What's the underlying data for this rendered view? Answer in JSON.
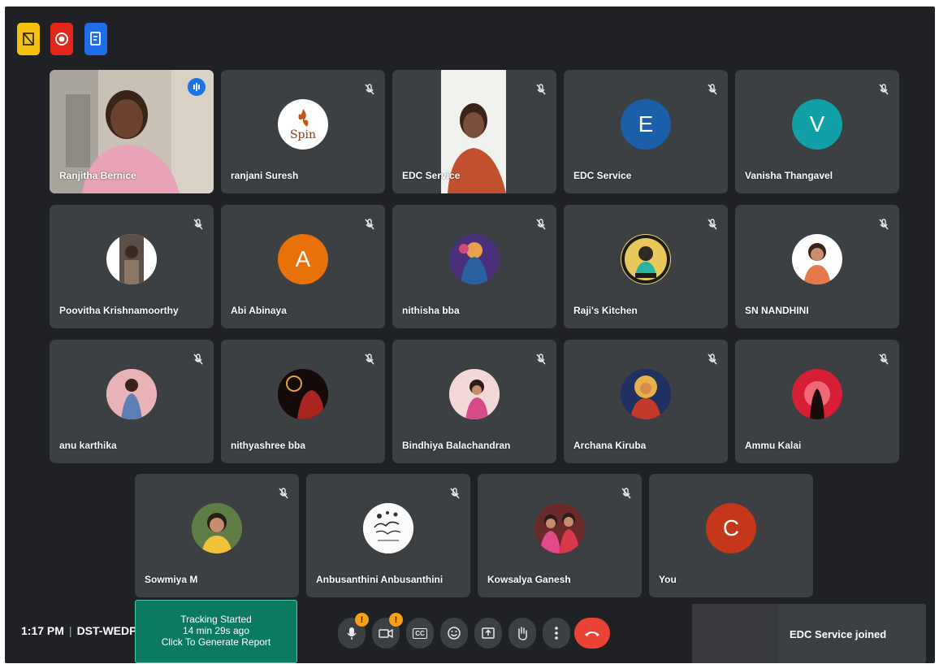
{
  "top_icons": [
    "tracker-icon",
    "record-icon",
    "notes-icon"
  ],
  "participants_row1": [
    {
      "name": "Ranjitha Bernice",
      "kind": "video",
      "active": true
    },
    {
      "name": "ranjani Suresh",
      "kind": "logo",
      "avatar_text": "Spin"
    },
    {
      "name": "EDC Service",
      "kind": "video"
    },
    {
      "name": "EDC Service",
      "kind": "letter",
      "avatar_text": "E",
      "color": "#1a5fa8"
    },
    {
      "name": "Vanisha Thangavel",
      "kind": "letter",
      "avatar_text": "V",
      "color": "#12a0a8"
    }
  ],
  "participants_row2": [
    {
      "name": "Poovitha Krishnamoorthy"
    },
    {
      "name": "Abi Abinaya",
      "avatar_text": "A",
      "color": "#e8710a"
    },
    {
      "name": "nithisha bba"
    },
    {
      "name": "Raji's Kitchen",
      "avatar_text": "RAJI'S KITCHEN"
    },
    {
      "name": "SN NANDHINI"
    }
  ],
  "participants_row3": [
    {
      "name": "anu karthika"
    },
    {
      "name": "nithyashree bba"
    },
    {
      "name": "Bindhiya Balachandran"
    },
    {
      "name": "Archana Kiruba"
    },
    {
      "name": "Ammu Kalai"
    }
  ],
  "participants_row4": [
    {
      "name": "Sowmiya M"
    },
    {
      "name": "Anbusanthini Anbusanthini"
    },
    {
      "name": "Kowsalya Ganesh"
    },
    {
      "name": "You",
      "avatar_text": "C",
      "color": "#c5371a"
    }
  ],
  "meeting": {
    "time": "1:17 PM",
    "separator": "|",
    "code": "DST-WEDP"
  },
  "tracking": {
    "line1": "Tracking Started",
    "line2": "14 min 29s ago",
    "line3": "Click To Generate Report"
  },
  "controls": {
    "mic_badge": "!",
    "camera_badge": "!",
    "captions_label": "CC"
  },
  "toast": {
    "text": "EDC Service joined"
  },
  "colors": {
    "bg": "#202124",
    "tile": "#3c4043",
    "hangup": "#ea4335",
    "tracking": "#0b7a63"
  }
}
